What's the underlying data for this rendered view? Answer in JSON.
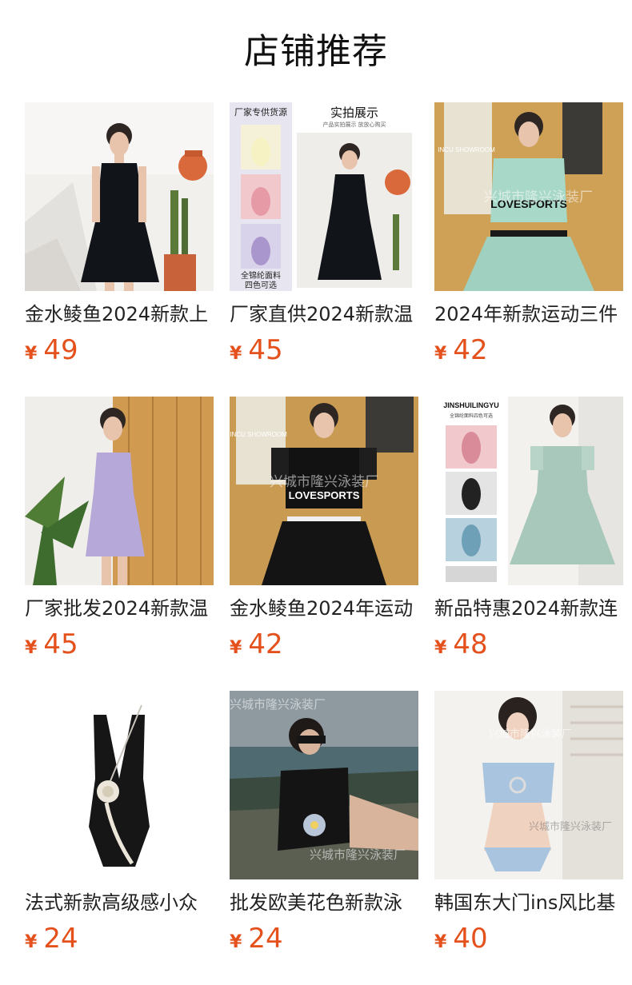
{
  "section": {
    "title": "店铺推荐"
  },
  "currency_symbol": "¥",
  "products": [
    {
      "name": "金水鲮鱼2024新款上",
      "price": "49",
      "image": "black-swim-dress-photo"
    },
    {
      "name": "厂家直供2024新款温",
      "price": "45",
      "image": "black-swim-dress-collage-photo",
      "image_text": {
        "left_header": "厂家专供货源",
        "right_header": "实拍展示",
        "right_sub": "产品实拍展示 放放心购买",
        "left_footer1": "全锦纶面料",
        "left_footer2": "四色可选"
      }
    },
    {
      "name": "2024年新款运动三件",
      "price": "42",
      "image": "mint-sport-set-photo",
      "image_text": {
        "watermark": "兴城市隆兴泳装厂",
        "shirt": "LOVESPORTS",
        "sign": "INCU SHOWROOM"
      }
    },
    {
      "name": "厂家批发2024新款温",
      "price": "45",
      "image": "lavender-swim-dress-photo"
    },
    {
      "name": "金水鲮鱼2024年运动",
      "price": "42",
      "image": "black-sport-set-photo",
      "image_text": {
        "watermark": "兴城市隆兴泳装厂",
        "shirt": "LOVESPORTS",
        "sign": "INCU SHOWROOM"
      }
    },
    {
      "name": "新品特惠2024新款连",
      "price": "48",
      "image": "mint-puff-sleeve-dress-photo",
      "image_text": {
        "brand": "JINSHUILINGYU",
        "sub": "全锦纶面料四色可选"
      }
    },
    {
      "name": "法式新款高级感小众",
      "price": "24",
      "image": "black-one-piece-rose-photo"
    },
    {
      "name": "批发欧美花色新款泳",
      "price": "24",
      "image": "black-floral-one-piece-beach-photo",
      "image_text": {
        "watermark": "兴城市隆兴泳装厂"
      }
    },
    {
      "name": "韩国东大门ins风比基",
      "price": "40",
      "image": "blue-bikini-photo",
      "image_text": {
        "watermark": "兴城市隆兴泳装厂"
      }
    }
  ],
  "colors": {
    "price": "#e5511d",
    "title": "#111111",
    "text": "#222222"
  }
}
